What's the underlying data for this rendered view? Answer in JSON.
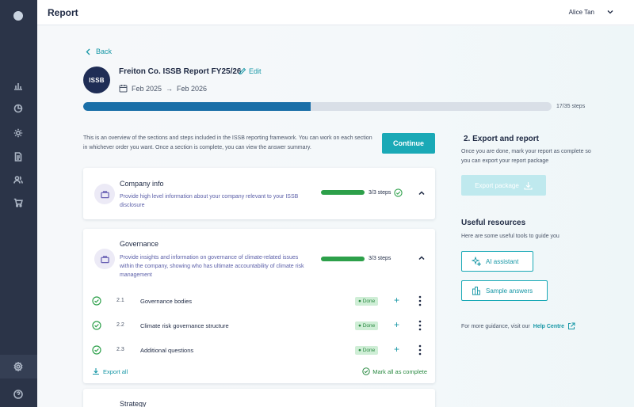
{
  "header": {
    "title": "Report",
    "user_name": "Alice Tan"
  },
  "navigation": {
    "back_label": "Back"
  },
  "report": {
    "logo_text": "ISSB",
    "title": "Freiton Co. ISSB Report FY25/26",
    "edit_label": "Edit",
    "start_date": "Feb 2025",
    "end_date": "Feb 2026",
    "arrow": "→",
    "progress_done": 17,
    "progress_total": 35,
    "progress_label": "17/35 steps"
  },
  "intro": {
    "text": "This is an overview of the sections and steps included in the ISSB reporting framework. You can work on each section in whichever order you want. Once a section is complete, you can view the answer summary.",
    "continue_label": "Continue"
  },
  "sections": [
    {
      "title": "Company info",
      "description": "Provide high level information about your company relevant to your ISSB disclosure",
      "steps_label": "3/3 steps"
    },
    {
      "title": "Governance",
      "description": "Provide insights and information on governance of climate-related issues within the company, showing who has ultimate accountability of climate risk management",
      "steps_label": "3/3 steps",
      "steps": [
        {
          "number": "2.1",
          "name": "Governance bodies",
          "status": "Done"
        },
        {
          "number": "2.2",
          "name": "Climate risk governance structure",
          "status": "Done"
        },
        {
          "number": "2.3",
          "name": "Additional questions",
          "status": "Done"
        }
      ],
      "export_all_label": "Export all",
      "mark_all_label": "Mark all as complete"
    },
    {
      "title": "Strategy"
    }
  ],
  "export_panel": {
    "title": "2.  Export and report",
    "description": "Once you are done, mark your report as complete so you can export your report package",
    "button_label": "Export package"
  },
  "resources": {
    "title": "Useful resources",
    "description": "Here are some useful tools to guide you",
    "ai_label": "AI assistant",
    "sample_label": "Sample answers",
    "guidance_text": "For more guidance, visit our",
    "help_link": "Help Centre"
  },
  "colors": {
    "accent": "#1aa9b6",
    "progress": "#1a6fa8",
    "success": "#2da04a",
    "sidebar": "#2b3448"
  }
}
